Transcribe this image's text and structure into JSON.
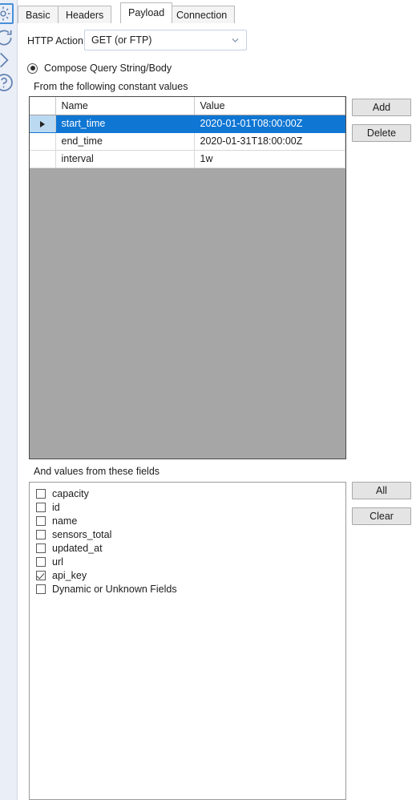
{
  "rail": {
    "icons": [
      {
        "name": "gear-icon",
        "selected": true
      },
      {
        "name": "refresh-icon",
        "selected": false
      },
      {
        "name": "chevron-right-icon",
        "selected": false
      },
      {
        "name": "help-icon",
        "selected": false
      }
    ]
  },
  "tabs": {
    "items": [
      {
        "label": "Basic",
        "active": false
      },
      {
        "label": "Headers",
        "active": false
      },
      {
        "label": "Payload",
        "active": true
      },
      {
        "label": "Connection",
        "active": false
      }
    ]
  },
  "http_action": {
    "label": "HTTP Action",
    "value": "GET (or FTP)",
    "dropdown_icon": "chevron-down-icon"
  },
  "compose": {
    "radio_label": "Compose Query String/Body",
    "radio_selected": true,
    "constants_caption": "From the following constant values",
    "fields_caption": "And values from these fields"
  },
  "grid": {
    "columns": [
      "",
      "Name",
      "Value"
    ],
    "rows": [
      {
        "selected": true,
        "name": "start_time",
        "value": "2020-01-01T08:00:00Z"
      },
      {
        "selected": false,
        "name": "end_time",
        "value": "2020-01-31T18:00:00Z"
      },
      {
        "selected": false,
        "name": "interval",
        "value": "1w"
      }
    ],
    "selection_color": "#0f76d3",
    "empty_area_color": "#a6a6a6"
  },
  "buttons": {
    "add": "Add",
    "delete": "Delete",
    "all": "All",
    "clear": "Clear"
  },
  "fields": {
    "items": [
      {
        "label": "capacity",
        "checked": false
      },
      {
        "label": "id",
        "checked": false
      },
      {
        "label": "name",
        "checked": false
      },
      {
        "label": "sensors_total",
        "checked": false
      },
      {
        "label": "updated_at",
        "checked": false
      },
      {
        "label": "url",
        "checked": false
      },
      {
        "label": "api_key",
        "checked": true
      },
      {
        "label": "Dynamic or Unknown Fields",
        "checked": false
      }
    ]
  }
}
